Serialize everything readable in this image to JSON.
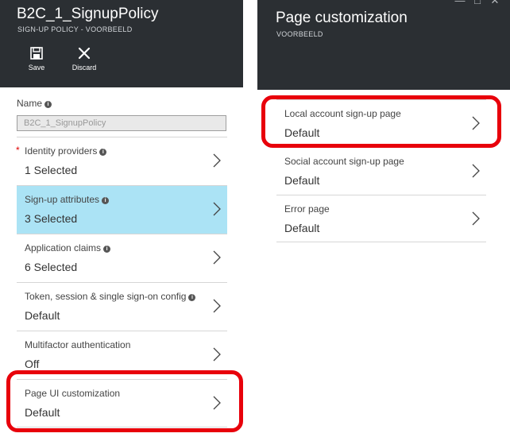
{
  "left": {
    "title": "B2C_1_SignupPolicy",
    "subtitle": "SIGN-UP POLICY - VOORBEELD",
    "commands": {
      "save_label": "Save",
      "discard_label": "Discard"
    },
    "name_label": "Name",
    "name_value": "B2C_1_SignupPolicy",
    "items": [
      {
        "label": "Identity providers",
        "value": "1 Selected"
      },
      {
        "label": "Sign-up attributes",
        "value": "3 Selected"
      },
      {
        "label": "Application claims",
        "value": "6 Selected"
      },
      {
        "label": "Token, session & single sign-on config",
        "value": "Default"
      },
      {
        "label": "Multifactor authentication",
        "value": "Off"
      },
      {
        "label": "Page UI customization",
        "value": "Default"
      }
    ]
  },
  "right": {
    "title": "Page customization",
    "subtitle": "VOORBEELD",
    "items": [
      {
        "label": "Local account sign-up page",
        "value": "Default"
      },
      {
        "label": "Social account sign-up page",
        "value": "Default"
      },
      {
        "label": "Error page",
        "value": "Default"
      }
    ]
  },
  "colors": {
    "header": "#2b2f33",
    "selected_row": "#abe3f5",
    "highlight": "#e8000b",
    "required": "#e00000"
  }
}
